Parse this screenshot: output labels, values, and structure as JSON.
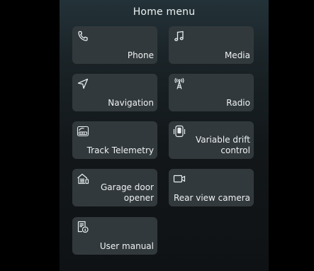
{
  "header": {
    "title": "Home menu"
  },
  "tiles": [
    {
      "label": "Phone",
      "icon": "phone-icon"
    },
    {
      "label": "Media",
      "icon": "music-note-icon"
    },
    {
      "label": "Navigation",
      "icon": "navigation-arrow-icon"
    },
    {
      "label": "Radio",
      "icon": "radio-tower-icon"
    },
    {
      "label": "Track Telemetry",
      "icon": "telemetry-gauge-icon"
    },
    {
      "label": "Variable drift\ncontrol",
      "icon": "drift-control-icon"
    },
    {
      "label": "Garage door\nopener",
      "icon": "garage-door-icon"
    },
    {
      "label": "Rear view camera",
      "icon": "camera-icon"
    },
    {
      "label": "User manual",
      "icon": "manual-book-icon"
    }
  ]
}
